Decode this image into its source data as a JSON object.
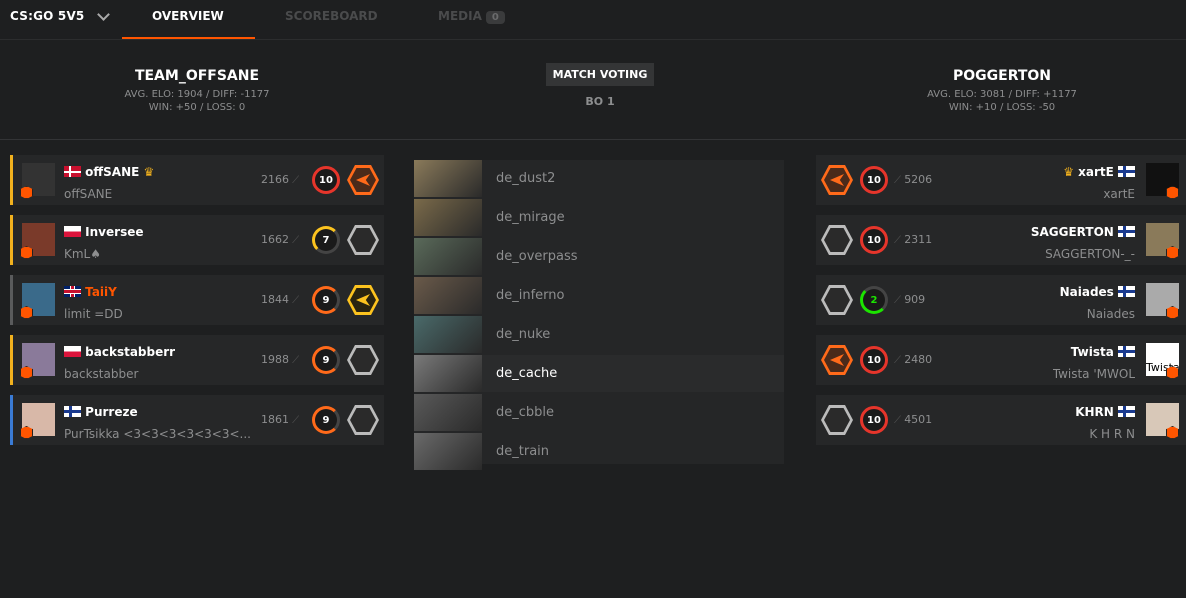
{
  "nav": {
    "game": "CS:GO 5V5",
    "tabs": [
      {
        "label": "OVERVIEW",
        "active": true
      },
      {
        "label": "SCOREBOARD",
        "active": false
      },
      {
        "label": "MEDIA",
        "active": false,
        "badge": "0"
      }
    ]
  },
  "team_left": {
    "name": "TEAM_OFFSANE",
    "stats1": "AVG. ELO: 1904 / DIFF: -1177",
    "stats2": "WIN: +50 / LOSS: 0",
    "players": [
      {
        "nick": "offSANE",
        "flag": "dk",
        "leader": true,
        "sub": "offSANE",
        "elo": "2166",
        "level": "10",
        "bar": "#f1b11e"
      },
      {
        "nick": "Inversee",
        "flag": "pl",
        "leader": false,
        "sub": "KmL♠",
        "elo": "1662",
        "level": "7",
        "bar": "#f1b11e"
      },
      {
        "nick": "TaiiY",
        "flag": "gb",
        "leader": false,
        "sub": "limit =DD",
        "elo": "1844",
        "level": "9",
        "bar": "#5a5b5c"
      },
      {
        "nick": "backstabberr",
        "flag": "pl",
        "leader": false,
        "sub": "backstabber",
        "elo": "1988",
        "level": "9",
        "bar": "#f1b11e"
      },
      {
        "nick": "Purreze",
        "flag": "fi",
        "leader": false,
        "sub": "PurTsikka <3<3<3<3<3<3<...",
        "elo": "1861",
        "level": "9",
        "bar": "#3a7bd5"
      }
    ]
  },
  "team_right": {
    "name": "POGGERTON",
    "stats1": "AVG. ELO: 3081 / DIFF: +1177",
    "stats2": "WIN: +10 / LOSS: -50",
    "players": [
      {
        "nick": "xartE",
        "flag": "fi",
        "leader": true,
        "sub": "xartE",
        "elo": "5206",
        "level": "10"
      },
      {
        "nick": "SAGGERTON",
        "flag": "fi",
        "leader": false,
        "sub": "SAGGERTON-_-",
        "elo": "2311",
        "level": "10"
      },
      {
        "nick": "Naiades",
        "flag": "fi",
        "leader": false,
        "sub": "Naiades",
        "elo": "909",
        "level": "2"
      },
      {
        "nick": "Twista",
        "flag": "fi",
        "leader": false,
        "sub": "Twista 'MWOL",
        "elo": "2480",
        "level": "10",
        "avatar_alt": "Twista"
      },
      {
        "nick": "KHRN",
        "flag": "fi",
        "leader": false,
        "sub": "K H R N",
        "elo": "4501",
        "level": "10"
      }
    ]
  },
  "voting": {
    "label": "MATCH VOTING",
    "format": "BO 1"
  },
  "maps": [
    {
      "name": "de_dust2",
      "selected": false,
      "color": "#8a7a5a"
    },
    {
      "name": "de_mirage",
      "selected": false,
      "color": "#7a6a4a"
    },
    {
      "name": "de_overpass",
      "selected": false,
      "color": "#5a6a5a"
    },
    {
      "name": "de_inferno",
      "selected": false,
      "color": "#6a5a4a"
    },
    {
      "name": "de_nuke",
      "selected": false,
      "color": "#4a6a6a"
    },
    {
      "name": "de_cache",
      "selected": true,
      "color": "#7a7a7a"
    },
    {
      "name": "de_cbble",
      "selected": false,
      "color": "#5a5a5a"
    },
    {
      "name": "de_train",
      "selected": false,
      "color": "#6a6a6a"
    }
  ],
  "colors": {
    "accent": "#ff5500",
    "bg": "#1e1f20",
    "card": "#262728"
  }
}
